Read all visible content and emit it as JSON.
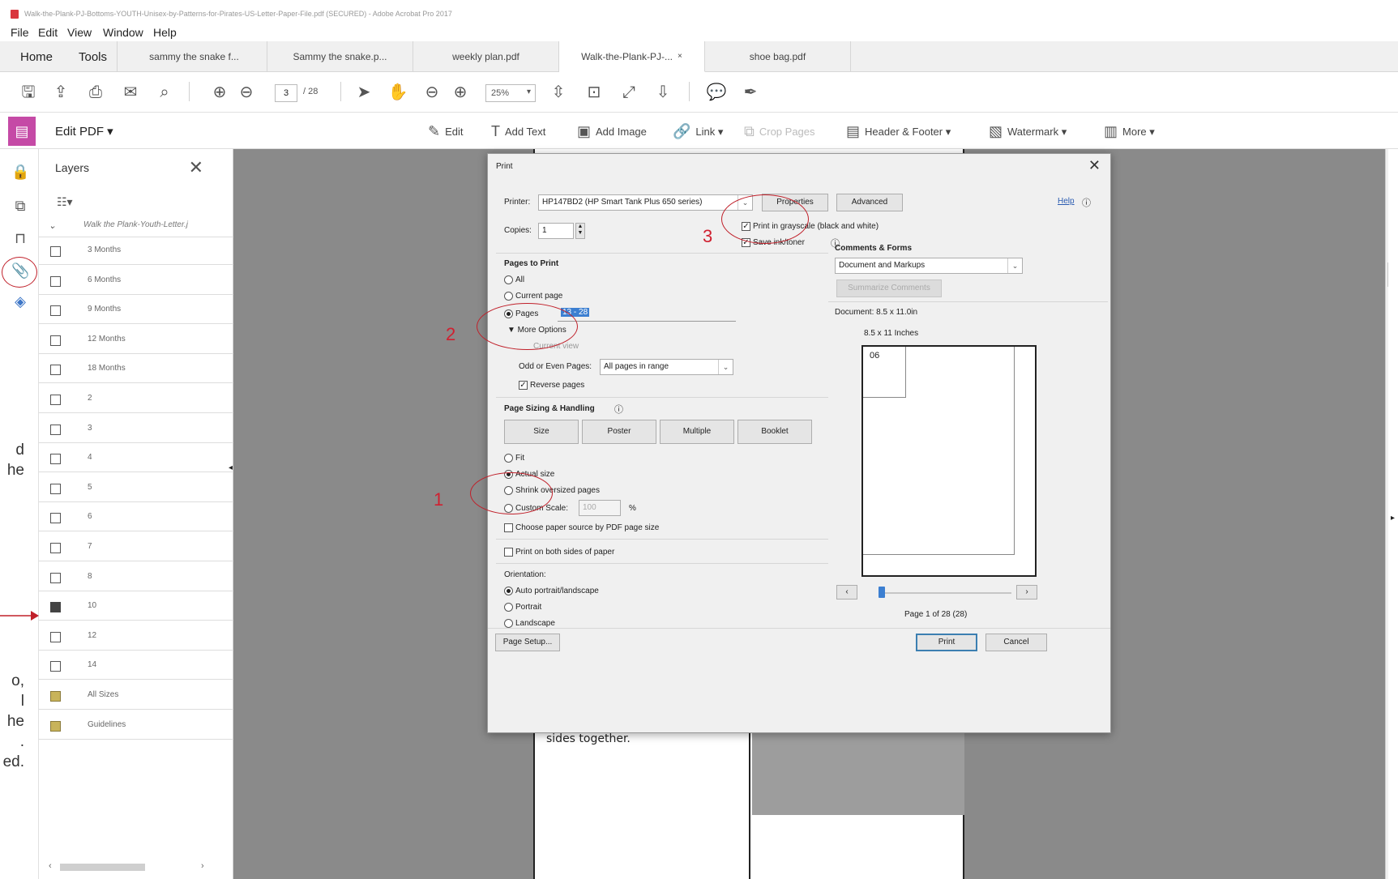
{
  "window": {
    "title": "Walk-the-Plank-PJ-Bottoms-YOUTH-Unisex-by-Patterns-for-Pirates-US-Letter-Paper-File.pdf (SECURED) - Adobe Acrobat Pro 2017"
  },
  "menu": [
    "File",
    "Edit",
    "View",
    "Window",
    "Help"
  ],
  "tabs": {
    "home": "Home",
    "tools": "Tools",
    "docs": [
      "sammy the snake f...",
      "Sammy the snake.p...",
      "weekly plan.pdf",
      "Walk-the-Plank-PJ-...",
      "shoe bag.pdf"
    ],
    "close": "×"
  },
  "toolbar": {
    "page_current": "3",
    "page_total": "/ 28",
    "zoom": "25%"
  },
  "edit_bar": {
    "title": "Edit PDF ▾",
    "edit": "Edit",
    "add_text": "Add Text",
    "add_image": "Add Image",
    "link": "Link ▾",
    "crop_pages": "Crop Pages",
    "header_footer": "Header & Footer ▾",
    "watermark": "Watermark ▾",
    "more": "More ▾"
  },
  "layers": {
    "title": "Layers",
    "root": "Walk the Plank-Youth-Letter.j",
    "items": [
      "3 Months",
      "6 Months",
      "9 Months",
      "12 Months",
      "18 Months",
      "2",
      "3",
      "4",
      "5",
      "6",
      "7",
      "8",
      "10",
      "12",
      "14",
      "All Sizes",
      "Guidelines"
    ]
  },
  "page": {
    "text": "Slide leg that is right side out into the other leg so they are right sides together."
  },
  "print_dialog": {
    "title": "Print",
    "printer_label": "Printer:",
    "printer_value": "HP147BD2 (HP Smart Tank Plus 650 series)",
    "properties": "Properties",
    "advanced": "Advanced",
    "help": "Help",
    "copies_label": "Copies:",
    "copies_value": "1",
    "grayscale": "Print in grayscale (black and white)",
    "save_ink": "Save ink/toner",
    "pages_to_print": "Pages to Print",
    "all": "All",
    "current_page": "Current page",
    "pages": "Pages",
    "pages_value": "13 - 28",
    "more_options": "▼  More Options",
    "current_view": "Current view",
    "odd_even_label": "Odd or Even Pages:",
    "odd_even_value": "All pages in range",
    "reverse_pages": "Reverse pages",
    "sizing_title": "Page Sizing & Handling",
    "size_btn": "Size",
    "poster_btn": "Poster",
    "multiple_btn": "Multiple",
    "booklet_btn": "Booklet",
    "fit": "Fit",
    "actual_size": "Actual size",
    "shrink": "Shrink oversized pages",
    "custom_scale": "Custom Scale:",
    "custom_scale_value": "100",
    "percent": "%",
    "choose_paper": "Choose paper source by PDF page size",
    "both_sides": "Print on both sides of paper",
    "orientation": "Orientation:",
    "auto": "Auto portrait/landscape",
    "portrait": "Portrait",
    "landscape": "Landscape",
    "comments_forms": "Comments & Forms",
    "comments_value": "Document and Markups",
    "summarize": "Summarize Comments",
    "document_size": "Document: 8.5 x 11.0in",
    "paper_size": "8.5 x 11 Inches",
    "preview_label": "06",
    "page_count": "Page 1 of 28 (28)",
    "page_setup": "Page Setup...",
    "print": "Print",
    "cancel": "Cancel"
  },
  "annotations": {
    "one": "1",
    "two": "2",
    "three": "3"
  },
  "crop_text": [
    "d",
    "he",
    "o,",
    "l",
    "he",
    ".",
    "ed."
  ],
  "colors": {
    "annotation": "#c0202a",
    "edit_accent": "#c54aa6",
    "selection": "#3c7fd1"
  }
}
